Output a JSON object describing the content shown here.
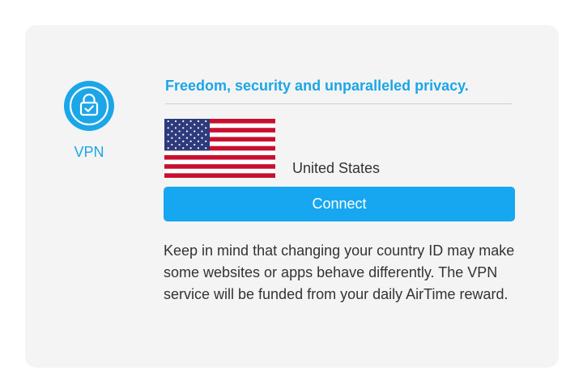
{
  "vpn": {
    "label": "VPN",
    "icon": "lock-check-icon"
  },
  "tagline": "Freedom, security and unparalleled privacy.",
  "country": {
    "name": "United States",
    "flag_icon": "us-flag-icon"
  },
  "connect_button": {
    "label": "Connect"
  },
  "notice": {
    "text": "Keep in mind that changing your country ID may make some websites or apps behave differently. The VPN service will be funded from your daily AirTime reward."
  },
  "colors": {
    "accent": "#1ba6e8",
    "button": "#17a7f0",
    "card_background": "#f4f4f4",
    "text": "#333333"
  }
}
